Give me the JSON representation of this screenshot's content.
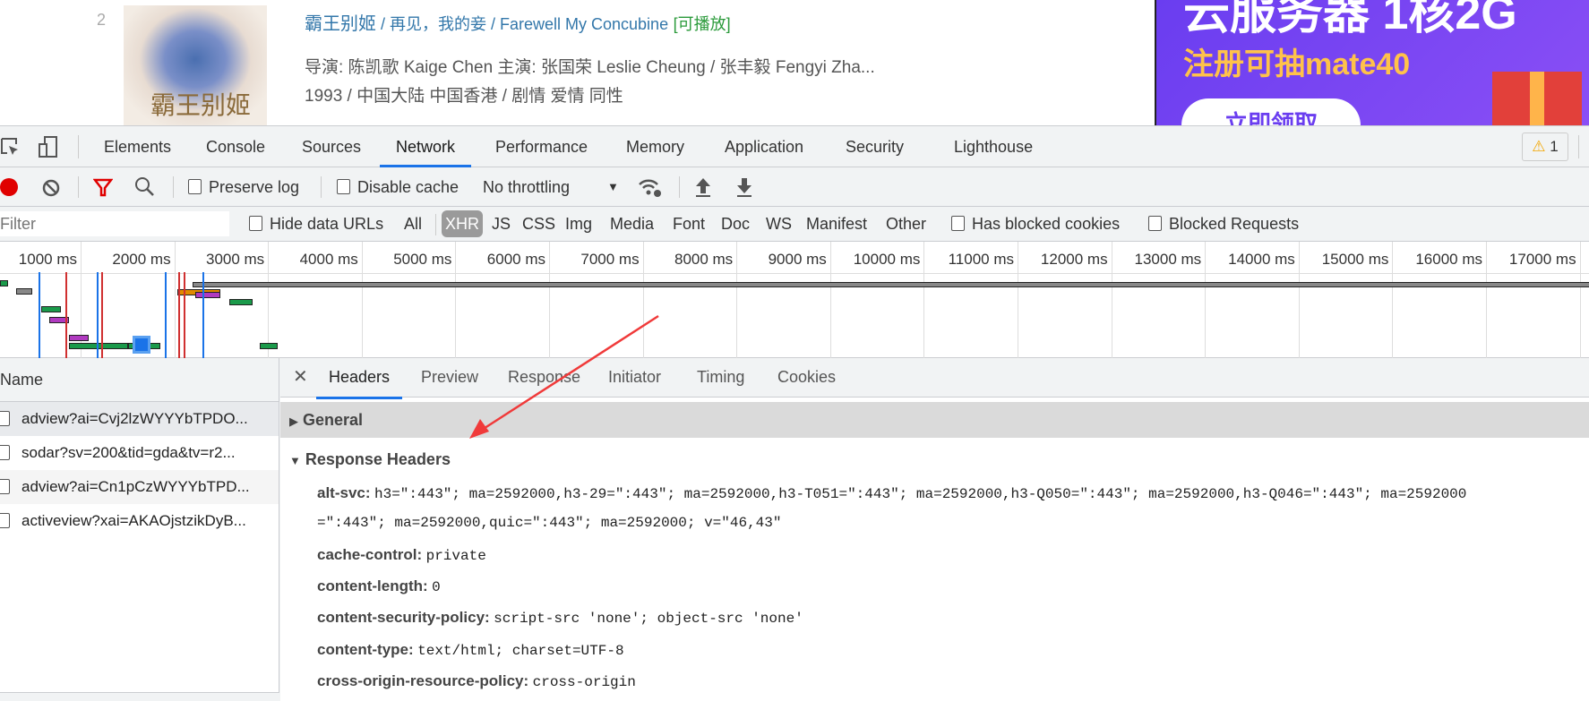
{
  "page": {
    "rank": "2",
    "poster_text": "霸王别姬",
    "title": "霸王别姬",
    "alt_titles": " / 再见，我的妾 / Farewell My Concubine",
    "playable": "[可播放]",
    "credits": "导演: 陈凯歌 Kaige Chen   主演: 张国荣 Leslie Cheung / 张丰毅 Fengyi Zha...",
    "info": "1993 / 中国大陆 中国香港 / 剧情 爱情 同性",
    "ad": {
      "line1": "云服务器 1核2G",
      "line2": "注册可抽mate40",
      "button": "立即领取"
    }
  },
  "devtools": {
    "tabs": [
      "Elements",
      "Console",
      "Sources",
      "Network",
      "Performance",
      "Memory",
      "Application",
      "Security",
      "Lighthouse"
    ],
    "active_tab": "Network",
    "warning_count": "1",
    "toolbar": {
      "preserve_log": "Preserve log",
      "disable_cache": "Disable cache",
      "throttling": "No throttling"
    },
    "filter": {
      "placeholder": "Filter",
      "hide_data_urls": "Hide data URLs",
      "types": [
        "All",
        "XHR",
        "JS",
        "CSS",
        "Img",
        "Media",
        "Font",
        "Doc",
        "WS",
        "Manifest",
        "Other"
      ],
      "active_type": "XHR",
      "has_blocked_cookies": "Has blocked cookies",
      "blocked_requests": "Blocked Requests"
    },
    "timeline_ticks": [
      "1000 ms",
      "2000 ms",
      "3000 ms",
      "4000 ms",
      "5000 ms",
      "6000 ms",
      "7000 ms",
      "8000 ms",
      "9000 ms",
      "10000 ms",
      "11000 ms",
      "12000 ms",
      "13000 ms",
      "14000 ms",
      "15000 ms",
      "16000 ms",
      "17000 ms"
    ],
    "list": {
      "header": "Name",
      "rows": [
        "adview?ai=Cvj2lzWYYYbTPDO...",
        "sodar?sv=200&tid=gda&tv=r2...",
        "adview?ai=Cn1pCzWYYYbTPD...",
        "activeview?xai=AKAOjstzikDyB..."
      ]
    },
    "detail": {
      "tabs": [
        "Headers",
        "Preview",
        "Response",
        "Initiator",
        "Timing",
        "Cookies"
      ],
      "active_tab": "Headers",
      "general": "General",
      "response_headers": "Response Headers",
      "headers": [
        {
          "name": "alt-svc:",
          "value": "h3=\":443\"; ma=2592000,h3-29=\":443\"; ma=2592000,h3-T051=\":443\"; ma=2592000,h3-Q050=\":443\"; ma=2592000,h3-Q046=\":443\"; ma=2592000"
        },
        {
          "name": "",
          "value": "=\":443\"; ma=2592000,quic=\":443\"; ma=2592000; v=\"46,43\""
        },
        {
          "name": "cache-control:",
          "value": "private"
        },
        {
          "name": "content-length:",
          "value": "0"
        },
        {
          "name": "content-security-policy:",
          "value": "script-src 'none'; object-src 'none'"
        },
        {
          "name": "content-type:",
          "value": "text/html; charset=UTF-8"
        },
        {
          "name": "cross-origin-resource-policy:",
          "value": "cross-origin"
        }
      ]
    }
  },
  "colors": {
    "accent": "#1a73e8",
    "record": "#e00000",
    "filter_icon": "#e00000",
    "arrow": "#f03a3a",
    "link": "#3377aa",
    "playable": "#2a9a3a"
  }
}
